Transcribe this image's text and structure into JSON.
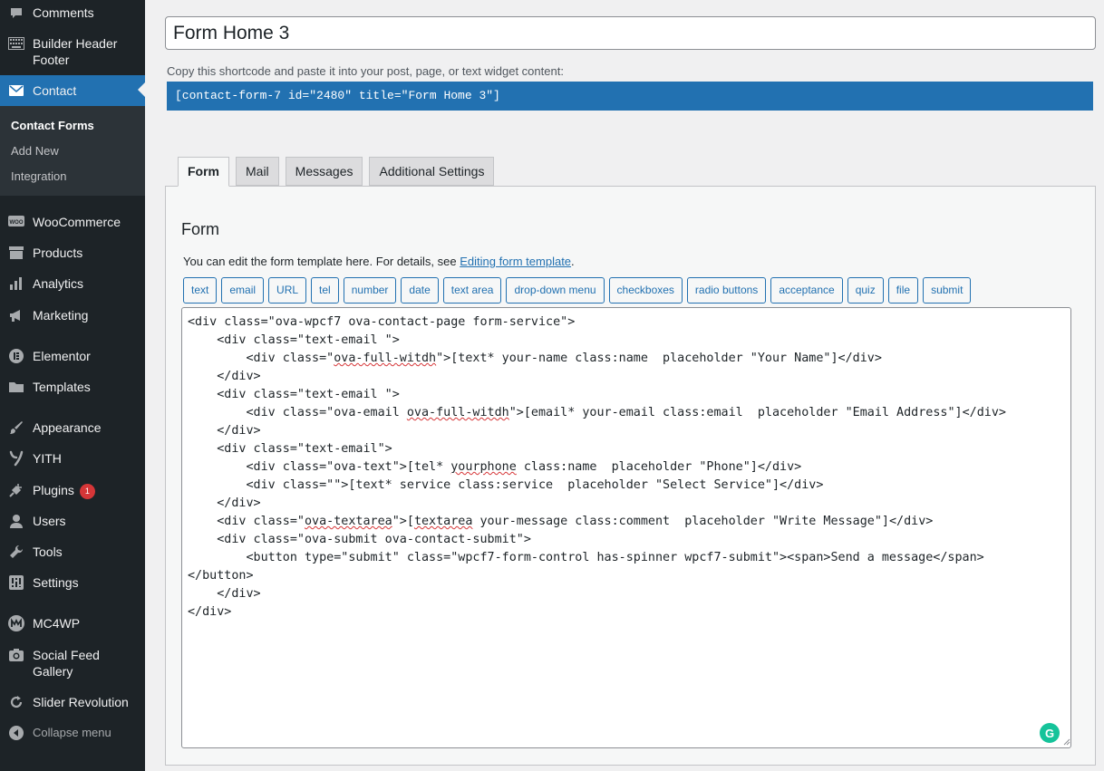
{
  "sidebar": {
    "items": [
      {
        "id": "comments",
        "label": "Comments",
        "icon": "comment-icon",
        "top": 0
      },
      {
        "id": "builder",
        "label": "Builder Header Footer",
        "icon": "keyboard-icon"
      },
      {
        "id": "contact",
        "label": "Contact",
        "icon": "envelope-icon"
      },
      {
        "id": "woocommerce",
        "label": "WooCommerce",
        "icon": "woo-icon"
      },
      {
        "id": "products",
        "label": "Products",
        "icon": "archive-icon"
      },
      {
        "id": "analytics",
        "label": "Analytics",
        "icon": "bar-chart-icon"
      },
      {
        "id": "marketing",
        "label": "Marketing",
        "icon": "megaphone-icon"
      },
      {
        "id": "elementor",
        "label": "Elementor",
        "icon": "elementor-icon"
      },
      {
        "id": "templates",
        "label": "Templates",
        "icon": "folder-icon"
      },
      {
        "id": "appearance",
        "label": "Appearance",
        "icon": "brush-icon"
      },
      {
        "id": "yith",
        "label": "YITH",
        "icon": "yith-icon"
      },
      {
        "id": "plugins",
        "label": "Plugins",
        "icon": "plug-icon",
        "badge": "1"
      },
      {
        "id": "users",
        "label": "Users",
        "icon": "user-icon"
      },
      {
        "id": "tools",
        "label": "Tools",
        "icon": "wrench-icon"
      },
      {
        "id": "settings",
        "label": "Settings",
        "icon": "sliders-icon"
      },
      {
        "id": "mc4wp",
        "label": "MC4WP",
        "icon": "mc4wp-icon"
      },
      {
        "id": "socialfeed",
        "label": "Social Feed Gallery",
        "icon": "camera-icon"
      },
      {
        "id": "slider",
        "label": "Slider Revolution",
        "icon": "refresh-icon"
      }
    ],
    "submenu": [
      "Contact Forms",
      "Add New",
      "Integration"
    ],
    "collapse_label": "Collapse menu"
  },
  "form": {
    "title_value": "Form Home 3",
    "shortcode_desc": "Copy this shortcode and paste it into your post, page, or text widget content:",
    "shortcode": "[contact-form-7 id=\"2480\" title=\"Form Home 3\"]",
    "tabs": [
      "Form",
      "Mail",
      "Messages",
      "Additional Settings"
    ],
    "panel_title": "Form",
    "desc_prefix": "You can edit the form template here. For details, see ",
    "desc_link": "Editing form template",
    "desc_suffix": ".",
    "tag_buttons": [
      "text",
      "email",
      "URL",
      "tel",
      "number",
      "date",
      "text area",
      "drop-down menu",
      "checkboxes",
      "radio buttons",
      "acceptance",
      "quiz",
      "file",
      "submit"
    ],
    "code_lines": [
      "<div class=\"ova-wpcf7 ova-contact-page form-service\">",
      "    <div class=\"text-email \">",
      "        <div class=\"ova-full-witdh\">[text* your-name class:name  placeholder \"Your Name\"]</div>",
      "    </div>",
      "    <div class=\"text-email \">",
      "        <div class=\"ova-email ova-full-witdh\">[email* your-email class:email  placeholder \"Email Address\"]</div>",
      "    </div>",
      "    <div class=\"text-email\">",
      "        <div class=\"ova-text\">[tel* yourphone class:name  placeholder \"Phone\"]</div>",
      "        <div class=\"\">[text* service class:service  placeholder \"Select Service\"]</div>",
      "    </div>",
      "    <div class=\"ova-textarea\">[textarea your-message class:comment  placeholder \"Write Message\"]</div>",
      "    <div class=\"ova-submit ova-contact-submit\">",
      "        <button type=\"submit\" class=\"wpcf7-form-control has-spinner wpcf7-submit\"><span>Send a message</span>",
      "</button>",
      "    </div>",
      "</div>"
    ],
    "squiggle_words": [
      "ova-full-witdh",
      "yourphone",
      "ova-textarea",
      "textarea"
    ],
    "grammarly_letter": "G"
  },
  "colors": {
    "sidebar_bg": "#1d2327",
    "accent": "#2271b1",
    "badge": "#d63638",
    "grammarly": "#15c39a"
  }
}
